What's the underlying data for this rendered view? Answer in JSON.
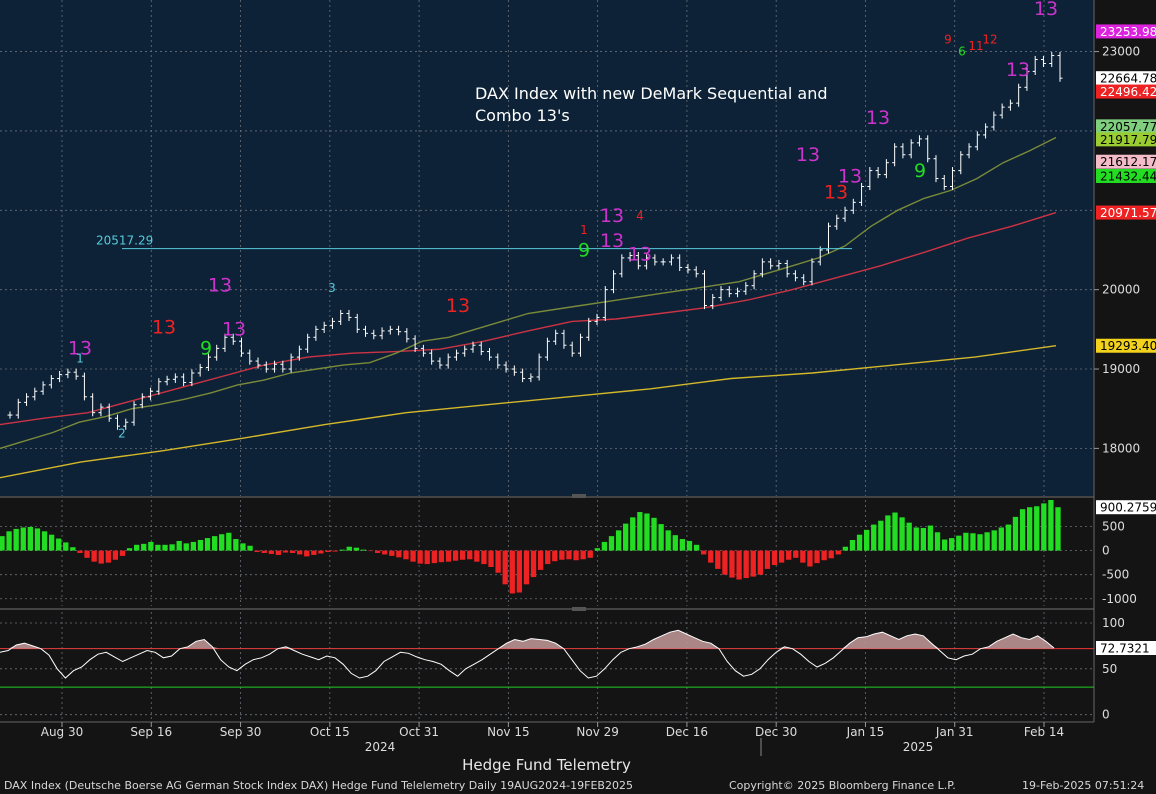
{
  "annotation": {
    "line1": "DAX Index with new DeMark Sequential and",
    "line2": "Combo 13's"
  },
  "bottom_title": "Hedge Fund Telemetry",
  "footer": {
    "left": "DAX Index (Deutsche Boerse AG German Stock Index DAX) Hedge Fund Telelemetry  Daily 19AUG2024-19FEB2025",
    "center": "Copyright© 2025 Bloomberg Finance L.P.",
    "right": "19-Feb-2025 07:51:24"
  },
  "colors": {
    "background": "#141414",
    "price_panel": "#0d2236",
    "up": "#22dd22",
    "down": "#ee2222",
    "ma_short": "#7a8a3a",
    "ma_mid": "#cc3344",
    "ma_long": "#d4b82a",
    "rsi_line": "#ffffff",
    "demark_13": "#cc33cc"
  },
  "chart_data": [
    {
      "type": "line",
      "name": "price",
      "y_axis_ticks": [
        18000,
        19000,
        20000,
        23000
      ],
      "ylim": [
        17400,
        23650
      ],
      "x_tick_labels": [
        "Aug 30",
        "Sep 16",
        "Sep 30",
        "Oct 15",
        "Oct 31",
        "Nov 15",
        "Nov 29",
        "Dec 16",
        "Dec 30",
        "Jan 15",
        "Jan 31",
        "Feb 14"
      ],
      "year_labels": [
        "2024",
        "2025"
      ],
      "close": [
        18420,
        18580,
        18650,
        18720,
        18800,
        18880,
        18930,
        18960,
        18910,
        18650,
        18450,
        18520,
        18380,
        18280,
        18330,
        18550,
        18650,
        18720,
        18840,
        18870,
        18900,
        18830,
        18950,
        19020,
        19150,
        19260,
        19400,
        19350,
        19200,
        19100,
        19050,
        19000,
        19060,
        19000,
        19150,
        19250,
        19400,
        19500,
        19550,
        19600,
        19700,
        19650,
        19500,
        19450,
        19420,
        19480,
        19500,
        19470,
        19380,
        19260,
        19200,
        19100,
        19050,
        19150,
        19200,
        19250,
        19300,
        19220,
        19150,
        19050,
        19000,
        18960,
        18880,
        18900,
        19150,
        19350,
        19450,
        19300,
        19200,
        19400,
        19600,
        19650,
        20000,
        20200,
        20400,
        20430,
        20300,
        20400,
        20350,
        20350,
        20400,
        20280,
        20250,
        20200,
        19800,
        19900,
        20000,
        19950,
        19980,
        20050,
        20200,
        20350,
        20300,
        20330,
        20200,
        20150,
        20100,
        20350,
        20500,
        20800,
        20900,
        21000,
        21100,
        21300,
        21500,
        21450,
        21600,
        21800,
        21700,
        21850,
        21900,
        21650,
        21400,
        21300,
        21500,
        21700,
        21800,
        21950,
        22050,
        22200,
        22300,
        22350,
        22550,
        22750,
        22900,
        22850,
        22950,
        22664.78
      ],
      "ma_short": [
        18000,
        18100,
        18200,
        18330,
        18400,
        18500,
        18550,
        18620,
        18700,
        18800,
        18860,
        18950,
        19000,
        19050,
        19080,
        19200,
        19350,
        19400,
        19500,
        19600,
        19700,
        19750,
        19800,
        19850,
        19900,
        19950,
        20000,
        20050,
        20100,
        20200,
        20300,
        20400,
        20550,
        20800,
        21000,
        21150,
        21250,
        21400,
        21600,
        21750,
        21917.79
      ],
      "ma_mid": [
        18300,
        18380,
        18450,
        18600,
        18750,
        18900,
        19050,
        19150,
        19200,
        19220,
        19250,
        19350,
        19480,
        19600,
        19630,
        19700,
        19770,
        19870,
        20000,
        20150,
        20300,
        20470,
        20650,
        20800,
        20971.57
      ],
      "ma_long": [
        17630,
        17830,
        17970,
        18130,
        18300,
        18450,
        18550,
        18650,
        18750,
        18880,
        18950,
        19050,
        19150,
        19293.4
      ],
      "last_price_labels": [
        {
          "text": "23253.98",
          "value": 23253.98,
          "color": "#dd22dd",
          "text_color": "#ffffff"
        },
        {
          "text": "22664.78",
          "value": 22664.78,
          "color": "#ffffff",
          "text_color": "#000000"
        },
        {
          "text": "22496.42",
          "value": 22496.42,
          "color": "#ee2222",
          "text_color": "#ffffff"
        },
        {
          "text": "22057.77",
          "value": 22057.77,
          "color": "#7fcf7f",
          "text_color": "#000000"
        },
        {
          "text": "21917.79",
          "value": 21917.79,
          "color": "#9acd32",
          "text_color": "#000000"
        },
        {
          "text": "21612.17",
          "value": 21612.17,
          "color": "#f4bcc8",
          "text_color": "#000000"
        },
        {
          "text": "21432.44",
          "value": 21432.44,
          "color": "#22dd22",
          "text_color": "#000000"
        },
        {
          "text": "20971.57",
          "value": 20971.57,
          "color": "#ee2222",
          "text_color": "#ffffff"
        },
        {
          "text": "19293.40",
          "value": 19293.4,
          "color": "#f2d21c",
          "text_color": "#000000"
        }
      ],
      "level_labels": [
        {
          "text": "20517.29",
          "value": 20517.29,
          "color": "#55ccdd"
        }
      ],
      "demark_counts": [
        {
          "text": "13",
          "i": 5,
          "y": 19180,
          "color": "#cc33cc",
          "big": true
        },
        {
          "text": "13",
          "i": 11,
          "y": 19450,
          "color": "#ee2222",
          "big": true
        },
        {
          "text": "13",
          "i": 15,
          "y": 19980,
          "color": "#cc33cc",
          "big": true
        },
        {
          "text": "13",
          "i": 16,
          "y": 19420,
          "color": "#cc33cc",
          "big": true
        },
        {
          "text": "9",
          "i": 14,
          "y": 19180,
          "color": "#22dd22",
          "big": true
        },
        {
          "text": "13",
          "i": 32,
          "y": 19720,
          "color": "#ee2222",
          "big": true
        },
        {
          "text": "13",
          "i": 43,
          "y": 20850,
          "color": "#cc33cc",
          "big": true
        },
        {
          "text": "13",
          "i": 43,
          "y": 20540,
          "color": "#cc33cc",
          "big": true
        },
        {
          "text": "9",
          "i": 41,
          "y": 20420,
          "color": "#22dd22",
          "big": true
        },
        {
          "text": "13",
          "i": 45,
          "y": 20370,
          "color": "#cc33cc",
          "big": true
        },
        {
          "text": "13",
          "i": 57,
          "y": 21620,
          "color": "#cc33cc",
          "big": true
        },
        {
          "text": "13",
          "i": 59,
          "y": 21150,
          "color": "#ee2222",
          "big": true
        },
        {
          "text": "13",
          "i": 60,
          "y": 21350,
          "color": "#cc33cc",
          "big": true
        },
        {
          "text": "13",
          "i": 62,
          "y": 22090,
          "color": "#cc33cc",
          "big": true
        },
        {
          "text": "9",
          "i": 65,
          "y": 21420,
          "color": "#22dd22",
          "big": true
        },
        {
          "text": "13",
          "i": 72,
          "y": 22690,
          "color": "#cc33cc",
          "big": true
        },
        {
          "text": "13",
          "i": 74,
          "y": 23460,
          "color": "#cc33cc",
          "big": true
        },
        {
          "text": "1",
          "i": 5,
          "y": 19080,
          "color": "#55ccdd",
          "big": false
        },
        {
          "text": "2",
          "i": 8,
          "y": 18140,
          "color": "#55ccdd",
          "big": false
        },
        {
          "text": "3",
          "i": 23,
          "y": 19970,
          "color": "#55ccdd",
          "big": false
        },
        {
          "text": "1",
          "i": 41,
          "y": 20700,
          "color": "#ee2222",
          "big": false
        },
        {
          "text": "4",
          "i": 45,
          "y": 20880,
          "color": "#ee2222",
          "big": false
        },
        {
          "text": "9",
          "i": 67,
          "y": 23100,
          "color": "#ee2222",
          "big": false
        },
        {
          "text": "6",
          "i": 68,
          "y": 22950,
          "color": "#22dd22",
          "big": false
        },
        {
          "text": "11",
          "i": 69,
          "y": 23020,
          "color": "#ee2222",
          "big": false
        },
        {
          "text": "12",
          "i": 70,
          "y": 23100,
          "color": "#ee2222",
          "big": false
        }
      ]
    },
    {
      "type": "bar",
      "name": "oscillator",
      "y_axis_ticks": [
        -1000,
        -500,
        0,
        500
      ],
      "ylim": [
        -1150,
        1050
      ],
      "last_value_label": "900.2759",
      "values": [
        300,
        400,
        450,
        480,
        490,
        460,
        400,
        330,
        250,
        170,
        70,
        -50,
        -150,
        -230,
        -270,
        -250,
        -190,
        -110,
        50,
        120,
        140,
        180,
        120,
        120,
        130,
        200,
        150,
        180,
        220,
        260,
        300,
        340,
        370,
        240,
        150,
        100,
        -30,
        -50,
        -70,
        -90,
        -40,
        -50,
        -80,
        -120,
        -90,
        -60,
        -30,
        -20,
        20,
        80,
        60,
        20,
        -10,
        -50,
        -80,
        -110,
        -140,
        -180,
        -230,
        -270,
        -280,
        -260,
        -240,
        -230,
        -210,
        -190,
        -180,
        -230,
        -280,
        -340,
        -460,
        -700,
        -890,
        -870,
        -700,
        -550,
        -400,
        -280,
        -220,
        -190,
        -180,
        -200,
        -180,
        -150,
        50,
        180,
        300,
        420,
        560,
        690,
        800,
        770,
        680,
        550,
        420,
        320,
        240,
        200,
        120,
        -80,
        -250,
        -380,
        -500,
        -560,
        -600,
        -570,
        -540,
        -500,
        -380,
        -300,
        -250,
        -190,
        -150,
        -250,
        -330,
        -260,
        -200,
        -160,
        -80,
        80,
        220,
        330,
        430,
        540,
        620,
        730,
        790,
        690,
        580,
        480,
        470,
        520,
        380,
        230,
        260,
        310,
        370,
        360,
        340,
        380,
        420,
        480,
        540,
        700,
        860,
        900,
        920,
        980,
        1050,
        900.28
      ]
    },
    {
      "type": "line",
      "name": "rsi",
      "y_axis_ticks": [
        0,
        50,
        100
      ],
      "ylim": [
        -8,
        112
      ],
      "last_value_label": "72.7321",
      "reference_levels": [
        {
          "value": 72,
          "color": "#ee3333"
        },
        {
          "value": 30,
          "color": "#22cc22"
        }
      ],
      "values": [
        68,
        70,
        76,
        78,
        75,
        72,
        65,
        50,
        40,
        48,
        52,
        60,
        66,
        68,
        63,
        58,
        62,
        66,
        70,
        68,
        62,
        64,
        72,
        74,
        80,
        82,
        74,
        60,
        52,
        48,
        55,
        60,
        62,
        66,
        72,
        74,
        70,
        66,
        63,
        60,
        64,
        62,
        55,
        45,
        40,
        42,
        48,
        58,
        63,
        68,
        67,
        63,
        60,
        58,
        55,
        48,
        42,
        50,
        55,
        60,
        66,
        72,
        78,
        82,
        80,
        83,
        82,
        81,
        78,
        72,
        60,
        48,
        40,
        42,
        50,
        60,
        68,
        72,
        74,
        77,
        82,
        86,
        90,
        92,
        88,
        84,
        80,
        78,
        72,
        58,
        48,
        42,
        44,
        50,
        60,
        68,
        74,
        72,
        66,
        58,
        52,
        56,
        62,
        70,
        78,
        84,
        85,
        88,
        90,
        86,
        82,
        86,
        88,
        86,
        78,
        70,
        62,
        60,
        64,
        66,
        72,
        74,
        80,
        84,
        88,
        84,
        82,
        86,
        80,
        72.73
      ]
    }
  ]
}
